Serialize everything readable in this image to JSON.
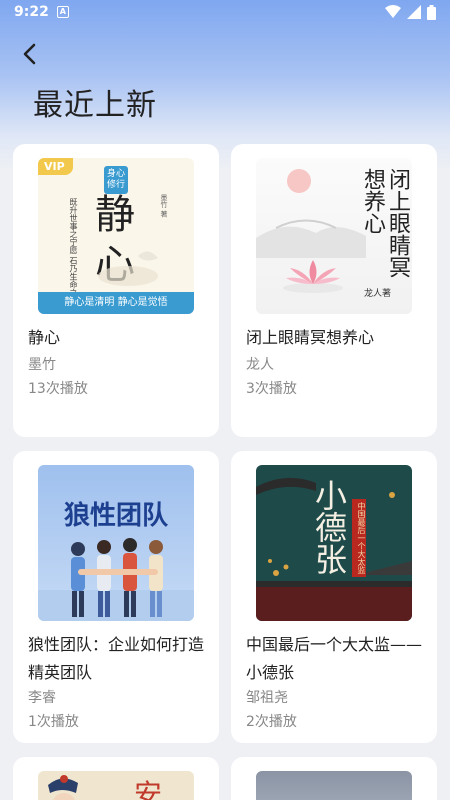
{
  "status_bar": {
    "time": "9:22",
    "app_icon_letter": "A"
  },
  "header": {
    "title": "最近上新"
  },
  "books": [
    {
      "title": "静心",
      "author": "墨竹",
      "plays": "13次播放",
      "cover": {
        "badge": "VIP",
        "tag": "身心修行",
        "main": "静心",
        "vertical_text": "既升世事之宁愿 石乃生命之修炼",
        "author_mark": "墨竹 著",
        "bottom_text": "静心是清明 静心是觉悟"
      }
    },
    {
      "title": "闭上眼睛冥想养心",
      "author": "龙人",
      "plays": "3次播放",
      "cover": {
        "main": "闭上眼睛冥想养心",
        "author_mark": "龙人著"
      }
    },
    {
      "title": "狼性团队：企业如何打造精英团队",
      "author": "李睿",
      "plays": "1次播放",
      "cover": {
        "main": "狼性团队"
      }
    },
    {
      "title": "中国最后一个大太监——小德张",
      "author": "邹祖尧",
      "plays": "2次播放",
      "cover": {
        "main": "小德张",
        "subtitle": "中国最后一个大太监"
      }
    },
    {
      "cover": {
        "main": "安"
      }
    },
    {
      "cover": {}
    }
  ],
  "colors": {
    "header_gradient_top": "#7fa7f0",
    "background": "#eef0f4",
    "card": "#ffffff",
    "vip": "#f2c94c"
  }
}
